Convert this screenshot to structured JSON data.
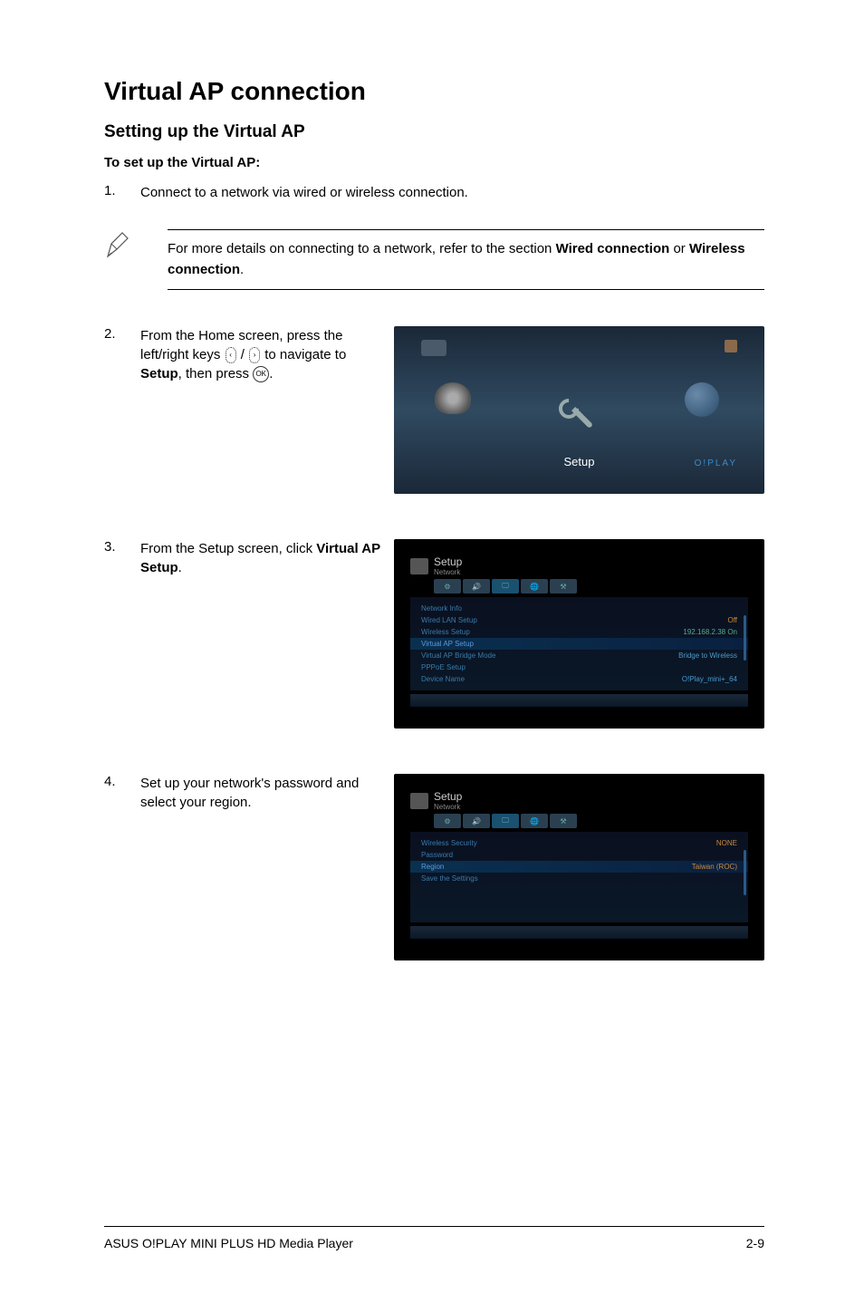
{
  "title": "Virtual AP connection",
  "subtitle": "Setting up the Virtual AP",
  "subheading": "To set up the Virtual AP:",
  "steps": {
    "s1": {
      "num": "1.",
      "text": "Connect to a network via wired or wireless connection."
    },
    "s2": {
      "num": "2.",
      "text_prefix": "From the Home screen, press the left/right keys ",
      "text_mid": " / ",
      "text_mid2": " to navigate to ",
      "setup_word": "Setup",
      "text_after_setup": ", then press ",
      "text_end": "."
    },
    "s3": {
      "num": "3.",
      "text_prefix": "From the Setup screen, click ",
      "bold": "Virtual AP Setup",
      "text_end": "."
    },
    "s4": {
      "num": "4.",
      "text": "Set up your network's password and select your region."
    }
  },
  "note": {
    "prefix": "For more details on connecting to a network, refer to the section ",
    "bold1": "Wired connection",
    "or": " or ",
    "bold2": "Wireless connection",
    "end": "."
  },
  "screenshot_home": {
    "label": "Setup",
    "brand": "O!PLAY"
  },
  "screenshot_network": {
    "title": "Setup",
    "subtitle": "Network",
    "rows": [
      {
        "label": "Network Info",
        "value": ""
      },
      {
        "label": "Wired LAN Setup",
        "value": "Off",
        "vclass": "orange"
      },
      {
        "label": "Wireless Setup",
        "value": "192.168.2.38 On",
        "vclass": "green"
      },
      {
        "label": "Virtual AP Setup",
        "value": "",
        "selected": true
      },
      {
        "label": "Virtual AP Bridge Mode",
        "value": "Bridge to Wireless"
      },
      {
        "label": "PPPoE Setup",
        "value": ""
      },
      {
        "label": "Device Name",
        "value": "O!Play_mini+_64"
      }
    ]
  },
  "screenshot_region": {
    "title": "Setup",
    "subtitle": "Network",
    "rows": [
      {
        "label": "Wireless Security",
        "value": "NONE",
        "vclass": "orange"
      },
      {
        "label": "Password",
        "value": ""
      },
      {
        "label": "Region",
        "value": "Taiwan (ROC)",
        "vclass": "orange",
        "selected": true
      },
      {
        "label": "Save the Settings",
        "value": ""
      }
    ]
  },
  "footer": {
    "left": "ASUS O!PLAY MINI PLUS HD Media Player",
    "right": "2-9"
  },
  "ok_label": "OK"
}
